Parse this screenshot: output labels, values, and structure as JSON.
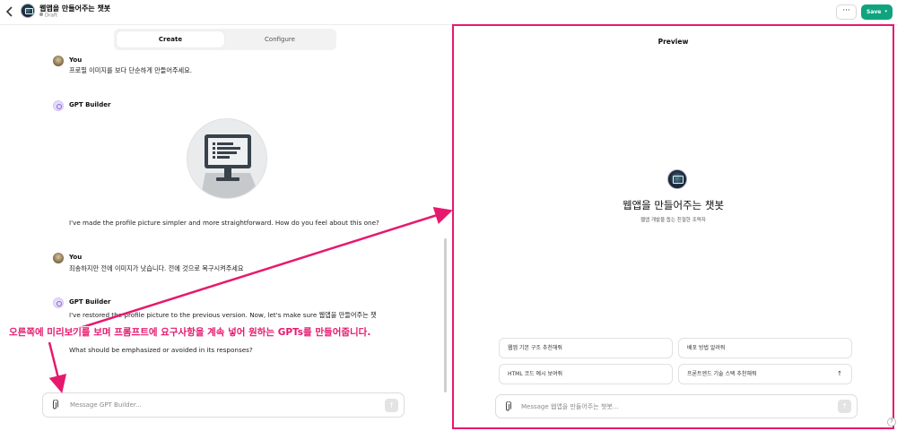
{
  "header": {
    "back_icon": "chevron-left-icon",
    "gpt_title": "웹앱을 만들어주는 챗봇",
    "status": "Draft",
    "more_label": "···",
    "save_label": "Save",
    "save_caret": "▾"
  },
  "tabs": [
    {
      "label": "Create",
      "active": true
    },
    {
      "label": "Configure",
      "active": false
    }
  ],
  "messages": [
    {
      "sender": "You",
      "text": "프로필 이미지를 보다 단순하게 만들어주세요."
    },
    {
      "sender": "GPT Builder",
      "text": "I've made the profile picture simpler and more straightforward. How do you feel about this one?"
    },
    {
      "sender": "You",
      "text": "죄송하지만 전에 이미지가 낫습니다. 전에 것으로 복구시켜주세요"
    },
    {
      "sender": "GPT Builder",
      "text_line1": "I've restored the profile picture to the previous version. Now, let's make sure 웹앱을 만들어주는 챗",
      "text_line2": "What should be emphasized or avoided in its responses?"
    }
  ],
  "composer": {
    "placeholder": "Message GPT Builder...",
    "send_icon": "↑"
  },
  "preview": {
    "title": "Preview",
    "gpt_name": "웹앱을 만들어주는 챗봇",
    "gpt_description": "웹앱 개발을 돕는 친절한 조력자",
    "starters": [
      "웹앱 기본 구조 추천해줘",
      "배포 방법 알려줘",
      "HTML 코드 예시 보여줘",
      "프론트엔드 기술 스택 추천해줘"
    ],
    "starter_send_icon": "↑",
    "composer_placeholder": "Message 웹앱을 만들어주는 챗봇...",
    "send_icon": "↑"
  },
  "help_label": "?",
  "annotation": {
    "text": "오른쪽에 미리보기를 보며 프롬프트에 요구사항을 계속 넣어 원하는 GPTs를 만들어줍니다.",
    "color": "#e6196e"
  },
  "colors": {
    "accent_save": "#10a37f",
    "highlight": "#e6196e"
  }
}
